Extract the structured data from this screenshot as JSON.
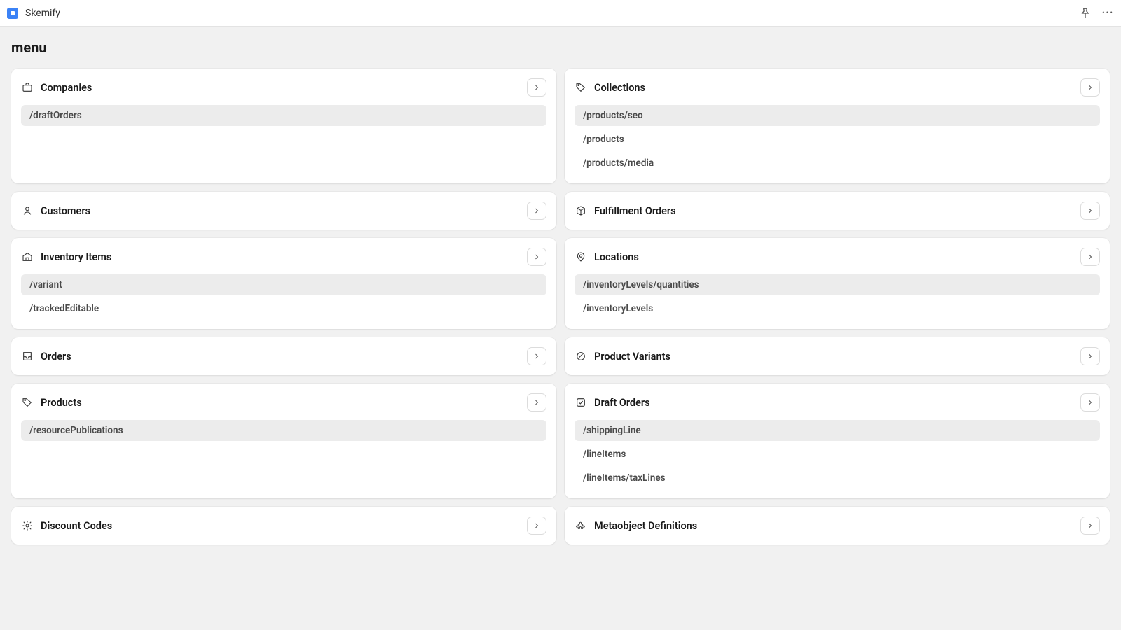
{
  "app": {
    "name": "Skemify"
  },
  "page": {
    "title": "menu"
  },
  "cards": {
    "companies": {
      "title": "Companies",
      "items": [
        "/draftOrders"
      ]
    },
    "collections": {
      "title": "Collections",
      "items": [
        "/products/seo",
        "/products",
        "/products/media"
      ]
    },
    "customers": {
      "title": "Customers",
      "items": []
    },
    "fulfillment": {
      "title": "Fulfillment Orders",
      "items": []
    },
    "inventory": {
      "title": "Inventory Items",
      "items": [
        "/variant",
        "/trackedEditable"
      ]
    },
    "locations": {
      "title": "Locations",
      "items": [
        "/inventoryLevels/quantities",
        "/inventoryLevels"
      ]
    },
    "orders": {
      "title": "Orders",
      "items": []
    },
    "variants": {
      "title": "Product Variants",
      "items": []
    },
    "products": {
      "title": "Products",
      "items": [
        "/resourcePublications"
      ]
    },
    "draftorders": {
      "title": "Draft Orders",
      "items": [
        "/shippingLine",
        "/lineItems",
        "/lineItems/taxLines"
      ]
    },
    "discounts": {
      "title": "Discount Codes",
      "items": []
    },
    "metaobjects": {
      "title": "Metaobject Definitions",
      "items": []
    }
  }
}
